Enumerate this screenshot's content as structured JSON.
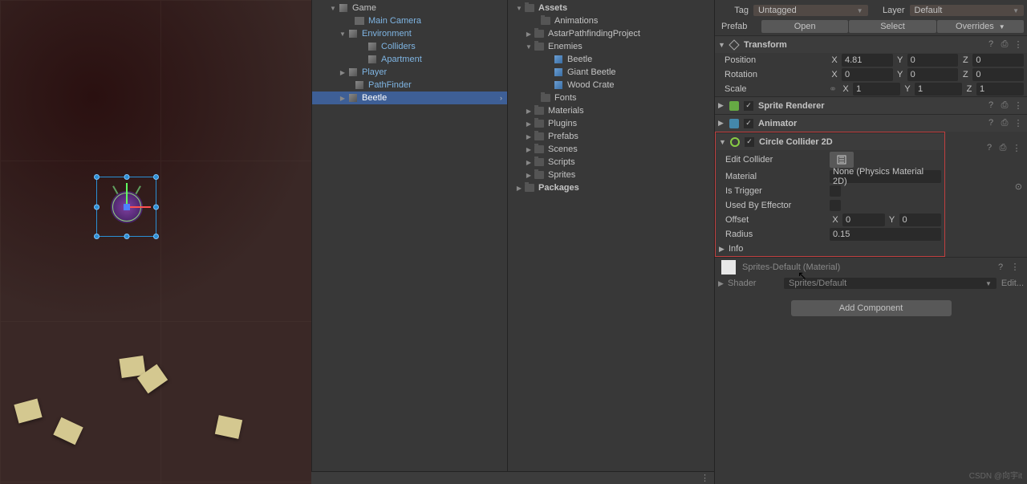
{
  "hierarchy": {
    "game": "Game",
    "mainCamera": "Main Camera",
    "environment": "Environment",
    "colliders": "Colliders",
    "apartment": "Apartment",
    "player": "Player",
    "pathFinder": "PathFinder",
    "beetle": "Beetle"
  },
  "project": {
    "assets": "Assets",
    "animations": "Animations",
    "astar": "AstarPathfindingProject",
    "enemies": "Enemies",
    "beetle": "Beetle",
    "giantBeetle": "Giant Beetle",
    "woodCrate": "Wood Crate",
    "fonts": "Fonts",
    "materials": "Materials",
    "plugins": "Plugins",
    "prefabs": "Prefabs",
    "scenes": "Scenes",
    "scripts": "Scripts",
    "sprites": "Sprites",
    "packages": "Packages"
  },
  "inspector": {
    "tag_label": "Tag",
    "tag_value": "Untagged",
    "layer_label": "Layer",
    "layer_value": "Default",
    "prefab_label": "Prefab",
    "open": "Open",
    "select": "Select",
    "overrides": "Overrides",
    "transform": {
      "name": "Transform",
      "position": "Position",
      "rotation": "Rotation",
      "scale": "Scale",
      "pos_x": "4.81",
      "pos_y": "0",
      "pos_z": "0",
      "rot_x": "0",
      "rot_y": "0",
      "rot_z": "0",
      "scl_x": "1",
      "scl_y": "1",
      "scl_z": "1"
    },
    "spriteRenderer": "Sprite Renderer",
    "animator": "Animator",
    "circleCollider": {
      "name": "Circle Collider 2D",
      "editCollider": "Edit Collider",
      "material": "Material",
      "material_val": "None (Physics Material 2D)",
      "isTrigger": "Is Trigger",
      "usedByEffector": "Used By Effector",
      "offset": "Offset",
      "offset_x": "0",
      "offset_y": "0",
      "radius": "Radius",
      "radius_val": "0.15",
      "info": "Info"
    },
    "material": {
      "name": "Sprites-Default (Material)",
      "shader_label": "Shader",
      "shader_val": "Sprites/Default",
      "edit": "Edit..."
    },
    "addComponent": "Add Component"
  },
  "watermark": "CSDN @向宇it",
  "axis": {
    "x": "X",
    "y": "Y",
    "z": "Z"
  }
}
